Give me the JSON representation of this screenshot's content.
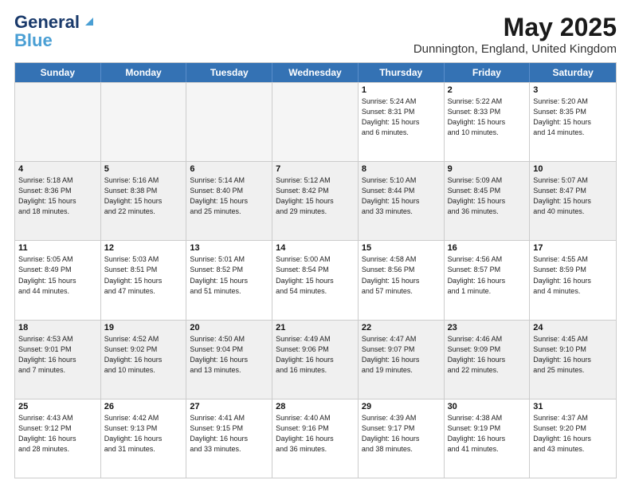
{
  "logo": {
    "line1": "General",
    "line2": "Blue"
  },
  "title": "May 2025",
  "subtitle": "Dunnington, England, United Kingdom",
  "headers": [
    "Sunday",
    "Monday",
    "Tuesday",
    "Wednesday",
    "Thursday",
    "Friday",
    "Saturday"
  ],
  "rows": [
    [
      {
        "day": "",
        "info": "",
        "empty": true
      },
      {
        "day": "",
        "info": "",
        "empty": true
      },
      {
        "day": "",
        "info": "",
        "empty": true
      },
      {
        "day": "",
        "info": "",
        "empty": true
      },
      {
        "day": "1",
        "info": "Sunrise: 5:24 AM\nSunset: 8:31 PM\nDaylight: 15 hours\nand 6 minutes."
      },
      {
        "day": "2",
        "info": "Sunrise: 5:22 AM\nSunset: 8:33 PM\nDaylight: 15 hours\nand 10 minutes."
      },
      {
        "day": "3",
        "info": "Sunrise: 5:20 AM\nSunset: 8:35 PM\nDaylight: 15 hours\nand 14 minutes."
      }
    ],
    [
      {
        "day": "4",
        "info": "Sunrise: 5:18 AM\nSunset: 8:36 PM\nDaylight: 15 hours\nand 18 minutes."
      },
      {
        "day": "5",
        "info": "Sunrise: 5:16 AM\nSunset: 8:38 PM\nDaylight: 15 hours\nand 22 minutes."
      },
      {
        "day": "6",
        "info": "Sunrise: 5:14 AM\nSunset: 8:40 PM\nDaylight: 15 hours\nand 25 minutes."
      },
      {
        "day": "7",
        "info": "Sunrise: 5:12 AM\nSunset: 8:42 PM\nDaylight: 15 hours\nand 29 minutes."
      },
      {
        "day": "8",
        "info": "Sunrise: 5:10 AM\nSunset: 8:44 PM\nDaylight: 15 hours\nand 33 minutes."
      },
      {
        "day": "9",
        "info": "Sunrise: 5:09 AM\nSunset: 8:45 PM\nDaylight: 15 hours\nand 36 minutes."
      },
      {
        "day": "10",
        "info": "Sunrise: 5:07 AM\nSunset: 8:47 PM\nDaylight: 15 hours\nand 40 minutes."
      }
    ],
    [
      {
        "day": "11",
        "info": "Sunrise: 5:05 AM\nSunset: 8:49 PM\nDaylight: 15 hours\nand 44 minutes."
      },
      {
        "day": "12",
        "info": "Sunrise: 5:03 AM\nSunset: 8:51 PM\nDaylight: 15 hours\nand 47 minutes."
      },
      {
        "day": "13",
        "info": "Sunrise: 5:01 AM\nSunset: 8:52 PM\nDaylight: 15 hours\nand 51 minutes."
      },
      {
        "day": "14",
        "info": "Sunrise: 5:00 AM\nSunset: 8:54 PM\nDaylight: 15 hours\nand 54 minutes."
      },
      {
        "day": "15",
        "info": "Sunrise: 4:58 AM\nSunset: 8:56 PM\nDaylight: 15 hours\nand 57 minutes."
      },
      {
        "day": "16",
        "info": "Sunrise: 4:56 AM\nSunset: 8:57 PM\nDaylight: 16 hours\nand 1 minute."
      },
      {
        "day": "17",
        "info": "Sunrise: 4:55 AM\nSunset: 8:59 PM\nDaylight: 16 hours\nand 4 minutes."
      }
    ],
    [
      {
        "day": "18",
        "info": "Sunrise: 4:53 AM\nSunset: 9:01 PM\nDaylight: 16 hours\nand 7 minutes."
      },
      {
        "day": "19",
        "info": "Sunrise: 4:52 AM\nSunset: 9:02 PM\nDaylight: 16 hours\nand 10 minutes."
      },
      {
        "day": "20",
        "info": "Sunrise: 4:50 AM\nSunset: 9:04 PM\nDaylight: 16 hours\nand 13 minutes."
      },
      {
        "day": "21",
        "info": "Sunrise: 4:49 AM\nSunset: 9:06 PM\nDaylight: 16 hours\nand 16 minutes."
      },
      {
        "day": "22",
        "info": "Sunrise: 4:47 AM\nSunset: 9:07 PM\nDaylight: 16 hours\nand 19 minutes."
      },
      {
        "day": "23",
        "info": "Sunrise: 4:46 AM\nSunset: 9:09 PM\nDaylight: 16 hours\nand 22 minutes."
      },
      {
        "day": "24",
        "info": "Sunrise: 4:45 AM\nSunset: 9:10 PM\nDaylight: 16 hours\nand 25 minutes."
      }
    ],
    [
      {
        "day": "25",
        "info": "Sunrise: 4:43 AM\nSunset: 9:12 PM\nDaylight: 16 hours\nand 28 minutes."
      },
      {
        "day": "26",
        "info": "Sunrise: 4:42 AM\nSunset: 9:13 PM\nDaylight: 16 hours\nand 31 minutes."
      },
      {
        "day": "27",
        "info": "Sunrise: 4:41 AM\nSunset: 9:15 PM\nDaylight: 16 hours\nand 33 minutes."
      },
      {
        "day": "28",
        "info": "Sunrise: 4:40 AM\nSunset: 9:16 PM\nDaylight: 16 hours\nand 36 minutes."
      },
      {
        "day": "29",
        "info": "Sunrise: 4:39 AM\nSunset: 9:17 PM\nDaylight: 16 hours\nand 38 minutes."
      },
      {
        "day": "30",
        "info": "Sunrise: 4:38 AM\nSunset: 9:19 PM\nDaylight: 16 hours\nand 41 minutes."
      },
      {
        "day": "31",
        "info": "Sunrise: 4:37 AM\nSunset: 9:20 PM\nDaylight: 16 hours\nand 43 minutes."
      }
    ]
  ]
}
